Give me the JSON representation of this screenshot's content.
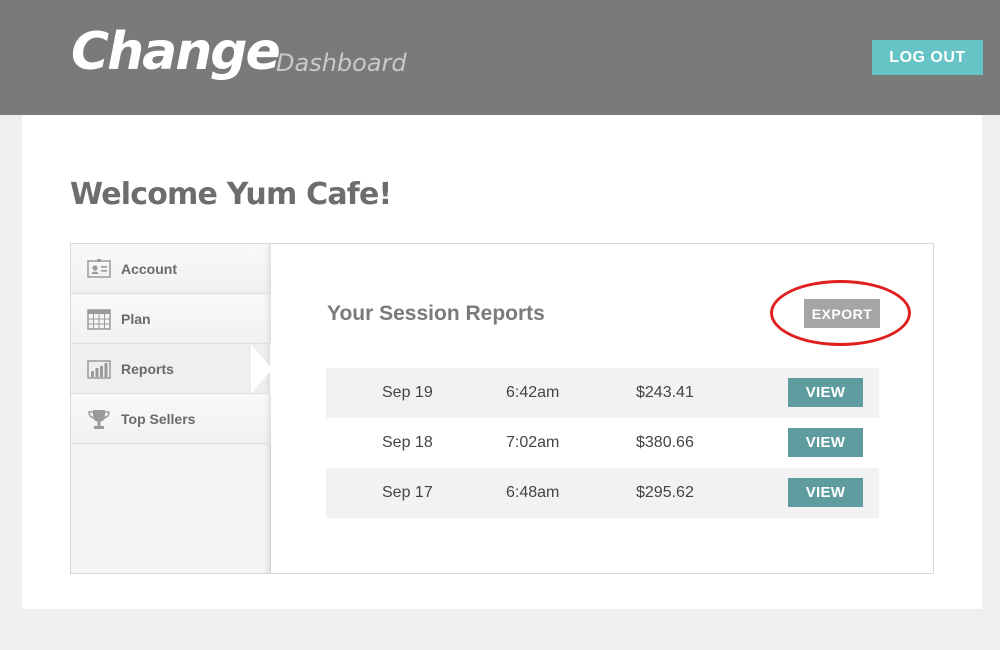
{
  "header": {
    "brand": "Change",
    "subtitle": "Dashboard",
    "logout_label": "LOG OUT"
  },
  "welcome": "Welcome Yum Cafe!",
  "sidebar": {
    "items": [
      {
        "label": "Account",
        "icon": "id-card-icon"
      },
      {
        "label": "Plan",
        "icon": "calendar-icon"
      },
      {
        "label": "Reports",
        "icon": "bar-chart-icon",
        "active": true
      },
      {
        "label": "Top Sellers",
        "icon": "trophy-icon"
      }
    ]
  },
  "reports": {
    "title": "Your Session Reports",
    "export_label": "EXPORT",
    "rows": [
      {
        "date": "Sep 19",
        "time": "6:42am",
        "amount": "$243.41",
        "action": "VIEW"
      },
      {
        "date": "Sep 18",
        "time": "7:02am",
        "amount": "$380.66",
        "action": "VIEW"
      },
      {
        "date": "Sep 17",
        "time": "6:48am",
        "amount": "$295.62",
        "action": "VIEW"
      }
    ]
  },
  "colors": {
    "topbar": "#7a7a7a",
    "accent": "#66c3c6",
    "view_button": "#5f9c9f",
    "export_button": "#a5a5a5",
    "highlight": "#e02020"
  }
}
